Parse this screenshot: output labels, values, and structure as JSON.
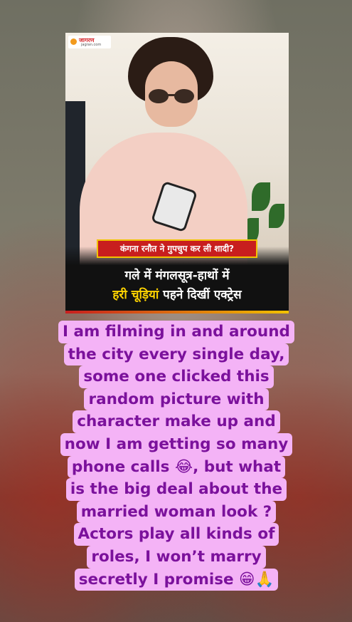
{
  "post": {
    "logo_name": "जागरण",
    "logo_domain": "jagran.com",
    "tag": "कंगना रनौत ने गुपचुप कर ली शादी?",
    "headline_line1": "गले में मंगलसूत्र-हाथों में",
    "headline_highlight": "हरी चूड़ियां",
    "headline_rest": " पहने दिखीं एक्ट्रेस"
  },
  "caption": {
    "lines": [
      "I am filming in and around",
      "the city every single day,",
      "some one clicked this",
      "random picture with",
      "character make up and",
      "now I am getting so many",
      "phone calls 😂, but what",
      "is the big deal about the",
      "married woman look ?",
      "Actors play all kinds of",
      "roles, I won’t marry",
      "secretly I promise 😁🙏"
    ]
  },
  "colors": {
    "caption_bg": "#f4b3f6",
    "caption_text": "#7b119c",
    "tag_bg": "#c81e1e",
    "highlight": "#ffd400"
  }
}
